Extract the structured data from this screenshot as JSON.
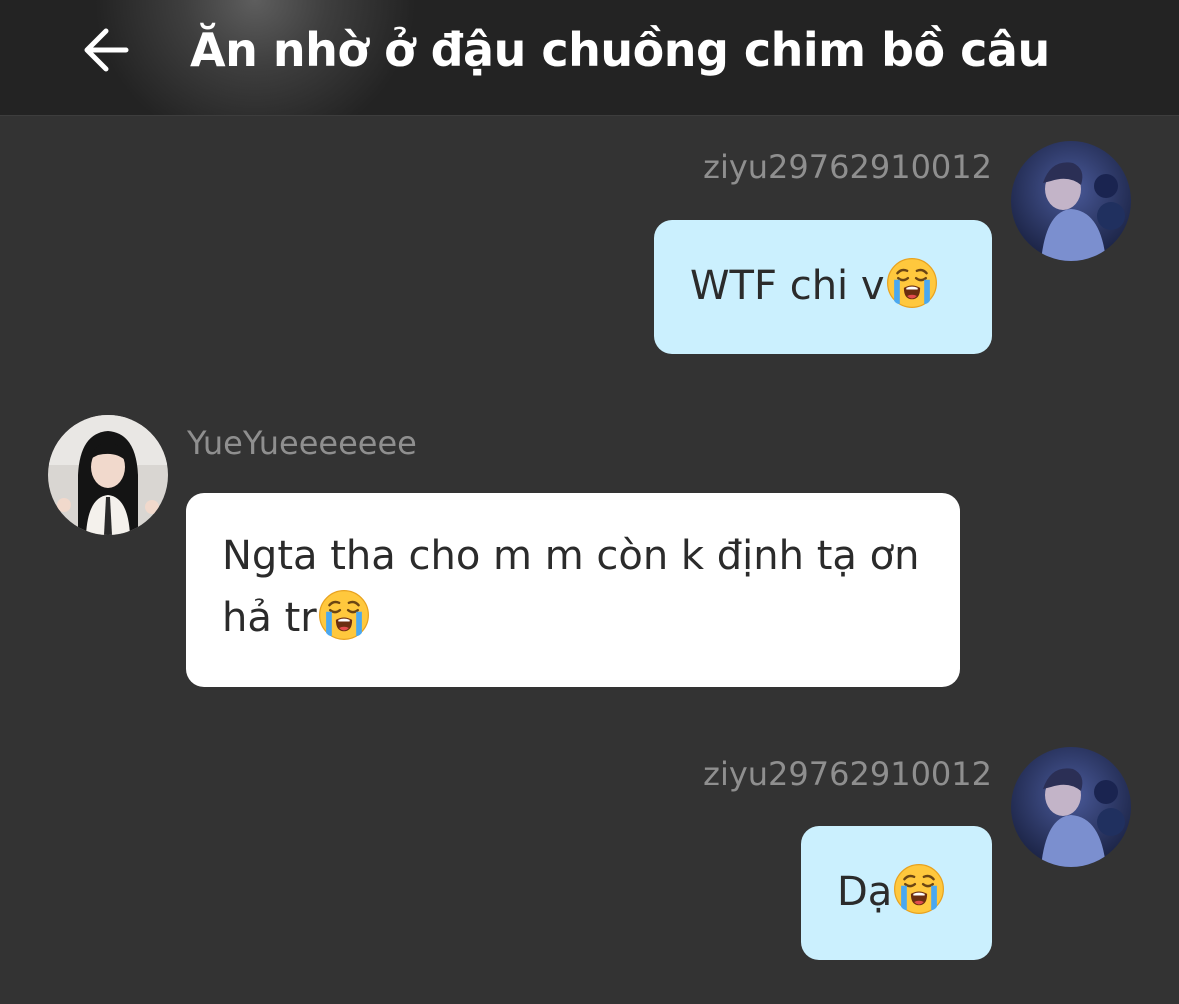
{
  "header": {
    "title": "Ăn nhờ ở đậu chuồng chim bồ câu"
  },
  "messages": [
    {
      "sender": "ziyu29762910012",
      "text": "WTF chi v",
      "emoji": "loudly-crying-face",
      "side": "right"
    },
    {
      "sender": "YueYueeeeeee",
      "text_line1": "Ngta tha cho m m còn k định tạ ơn",
      "text_line2": "hả tr",
      "emoji": "loudly-crying-face",
      "side": "left"
    },
    {
      "sender": "ziyu29762910012",
      "text": "Dạ",
      "emoji": "loudly-crying-face",
      "side": "right"
    }
  ],
  "colors": {
    "background": "#333333",
    "header": "#232323",
    "my_bubble": "#cbf0fe",
    "their_bubble": "#ffffff",
    "username": "#8f8f8f"
  }
}
